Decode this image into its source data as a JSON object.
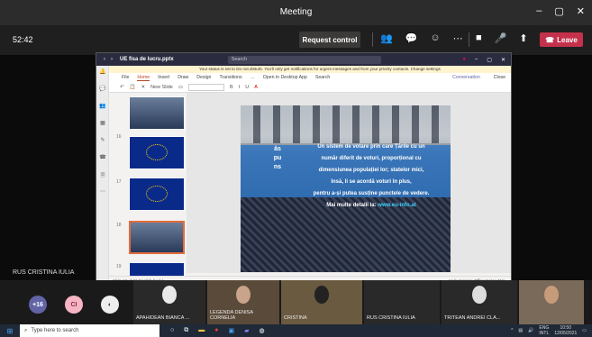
{
  "window": {
    "title": "Meeting",
    "controls": [
      "–",
      "▢",
      "✕"
    ]
  },
  "toolbar": {
    "timer": "52:42",
    "request_control": "Request control",
    "icons": [
      "people-icon",
      "chat-icon",
      "reactions-icon",
      "more-icon"
    ],
    "media": [
      "camera-icon",
      "mic-icon",
      "share-icon"
    ],
    "leave": "Leave"
  },
  "presenter": {
    "name": "RUS CRISTINA IULIA"
  },
  "share": {
    "file": "UE fisa de lucru.pptx",
    "search": "Search",
    "notice": "Your status is set to Do not disturb. You'll only get notifications for urgent messages and from your priority contacts. Change settings",
    "tabs": [
      "File",
      "Home",
      "Insert",
      "Draw",
      "Design",
      "Transitions",
      "…",
      "Open in Desktop App",
      "Search"
    ],
    "ribbon_new_slide": "New Slide",
    "ribbon_right": [
      "Conversation",
      "Close"
    ],
    "thumb_numbers": [
      "16",
      "17",
      "18",
      "19"
    ],
    "slide": {
      "vertical": "ăspuns",
      "lines": [
        "Un sistem de votare prin care Țările cu un",
        "număr diferit de voturi, proporțional cu",
        "dimensiunea populației lor; statelor mici,",
        "însă, li se acordă voturi în plus, ",
        "pentru a-și putea susține punctele de vedere."
      ],
      "more": "Mai multe detalii la: ",
      "link": "www.eu-info.at"
    },
    "status_left": "Slide 18 of 33    English (U.S.)",
    "status_right": "Help Improve Office   Notes    71%"
  },
  "participants": [
    {
      "initials": "+16",
      "color": "#6264a7"
    },
    {
      "initials": "CI",
      "color": "#f7b5c4"
    },
    {
      "initials": "",
      "color": "#eee"
    }
  ],
  "tiles": [
    {
      "name": "APAHIDEAN BIANCA ..."
    },
    {
      "name": "LEGENDA DENISA CORNELIA"
    },
    {
      "name": "CRISTINA"
    },
    {
      "name": "RUS CRISTINA IULIA"
    },
    {
      "name": "TRITEAN ANDREI CLA..."
    }
  ],
  "taskbar": {
    "search": "Type here to search",
    "lang": "ENG",
    "region": "INTL",
    "time": "10:50",
    "date": "12/05/2021"
  }
}
